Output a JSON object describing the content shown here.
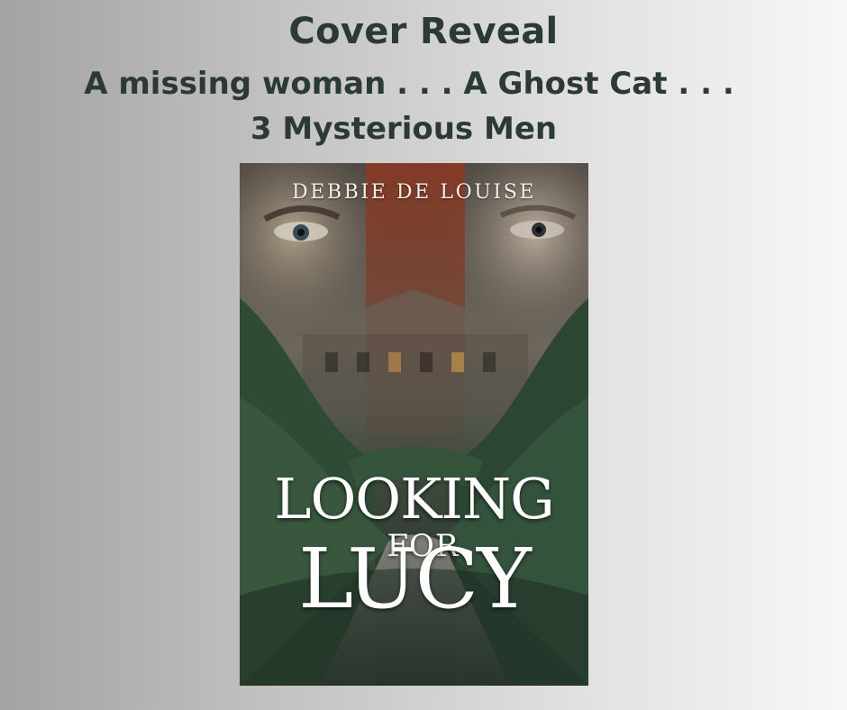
{
  "header": {
    "title": "Cover Reveal",
    "tagline_line1": "A missing woman . . . A Ghost Cat . . .",
    "tagline_line2": "3 Mysterious Men"
  },
  "book": {
    "author": "DEBBIE DE LOUISE",
    "title_line1": "LOOKING",
    "title_line2": "FOR",
    "title_line3": "LUCY"
  },
  "colors": {
    "heading_text": "#2b3a34",
    "cover_foliage": "#2f4a35",
    "cover_title": "#ffffff"
  }
}
